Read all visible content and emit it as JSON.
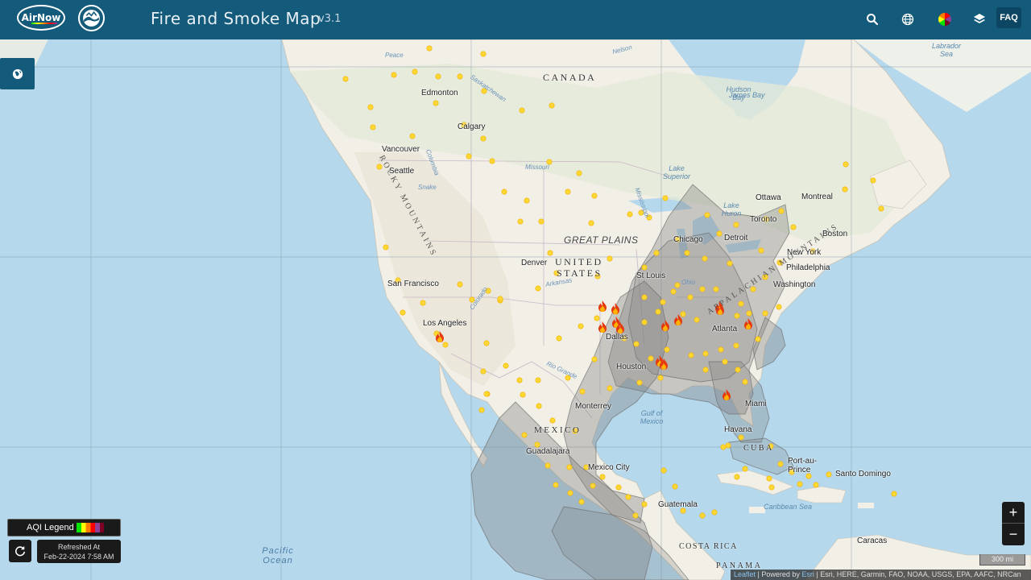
{
  "header": {
    "logo_text": "AirNow",
    "title": "Fire and Smoke Map",
    "version": "v3.1",
    "faq_label": "FAQ",
    "icons": [
      "search-icon",
      "globe-icon",
      "color-wheel-icon",
      "layers-icon"
    ]
  },
  "colors": {
    "header": "#145a7a",
    "land": "#f2efe6",
    "water": "#b5d8ec",
    "smoke": "#808080",
    "aqi_good": "#fdd835"
  },
  "legend": {
    "label": "AQI Legend"
  },
  "refresh": {
    "line1": "Refreshed At",
    "line2": "Feb-22-2024 7:58 AM"
  },
  "zoom": {
    "in": "+",
    "out": "−"
  },
  "scale": {
    "label": "300 mi"
  },
  "attribution": {
    "leaflet": "Leaflet",
    "sep": " | Powered by ",
    "esri": "Esri",
    "rest": " | Esri, HERE, Garmin, FAO, NOAA, USGS, EPA, AAFC, NRCan"
  },
  "map_labels": {
    "countries": [
      "CANADA",
      "UNITED",
      "STATES",
      "MEXICO",
      "CUBA",
      "COSTA RICA",
      "PANAMA"
    ],
    "regions": [
      "GREAT PLAINS"
    ],
    "mountains": [
      "ROCKY MOUNTAINS",
      "APPALACHIAN MOUNTAINS"
    ],
    "cities": [
      "Edmonton",
      "Calgary",
      "Vancouver",
      "Seattle",
      "Denver",
      "San Francisco",
      "Los Angeles",
      "Dallas",
      "Houston",
      "St Louis",
      "Chicago",
      "Detroit",
      "Toronto",
      "Ottawa",
      "Montreal",
      "Boston",
      "New York",
      "Philadelphia",
      "Washington",
      "Atlanta",
      "Miami",
      "Havana",
      "Monterrey",
      "Guadalajara",
      "Mexico City",
      "Guatemala",
      "Port-au-Prince",
      "Santo Domingo",
      "Caracas"
    ],
    "waters": [
      "Hudson Bay",
      "James Bay",
      "Labrador Sea",
      "Lake Superior",
      "Lake Huron",
      "Gulf of Mexico",
      "Caribbean Sea",
      "Pacific Ocean"
    ],
    "rivers": [
      "Peace",
      "Saskatchewan",
      "Nelson",
      "Missouri",
      "Columbia",
      "Snake",
      "Mississippi",
      "Ohio",
      "Arkansas",
      "Colorado",
      "Rio Grande"
    ]
  },
  "fire_count": 14
}
